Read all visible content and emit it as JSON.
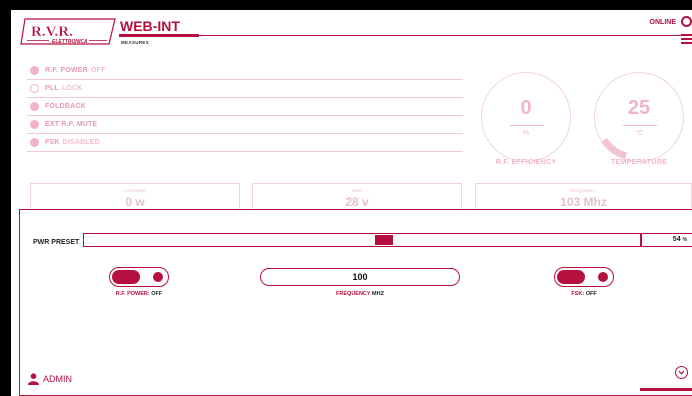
{
  "header": {
    "logo_text": "R.V.R.",
    "logo_sub": "ELETTRONICA",
    "title": "WEB-INT",
    "subtitle": "MEASURES",
    "connection_status": "ONLINE"
  },
  "status_rows": [
    {
      "label": "R.F. POWER",
      "value": "OFF",
      "indicator": "filled"
    },
    {
      "label": "PLL",
      "value": "LOCK",
      "indicator": "hollow"
    },
    {
      "label": "FOLDBACK",
      "value": "",
      "indicator": "filled"
    },
    {
      "label": "EXT R.F. MUTE",
      "value": "",
      "indicator": "filled"
    },
    {
      "label": "FSK",
      "value": "DISABLED",
      "indicator": "filled"
    }
  ],
  "gauges": {
    "efficiency": {
      "value": "0",
      "unit": "%",
      "label": "R.F. EFFICIENCY"
    },
    "temperature": {
      "value": "25",
      "unit": "°C",
      "label": "TEMPERATURE"
    }
  },
  "measures": [
    {
      "label": "FORWARD",
      "value": "0 w"
    },
    {
      "label": "SWR",
      "value": "28 v"
    },
    {
      "label": "FREQUENCY",
      "value": "103 Mhz"
    }
  ],
  "controls": {
    "preset_label": "PWR PRESET",
    "preset_value": "54",
    "preset_unit": "%",
    "rf_power_label": "R.F. POWER:",
    "rf_power_state": "OFF",
    "frequency_value": "100",
    "frequency_label": "FREQUENCY",
    "frequency_unit": "MHZ",
    "fsk_label": "FSK:",
    "fsk_state": "OFF"
  },
  "footer": {
    "user": "ADMIN"
  },
  "colors": {
    "accent": "#b5103f",
    "muted": "#f0b6c6"
  },
  "icons": [
    "status-circle-icon",
    "hamburger-menu-icon",
    "user-icon",
    "chevron-down-icon"
  ]
}
